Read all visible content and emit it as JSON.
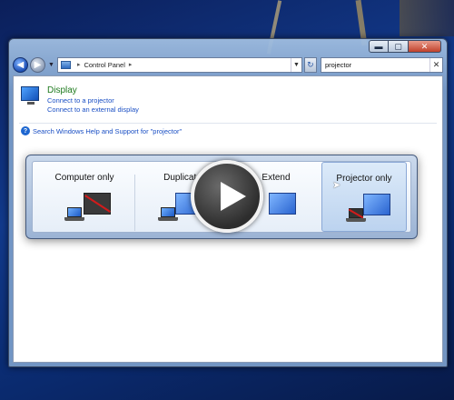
{
  "window": {
    "caption_buttons": {
      "minimize": "▬",
      "maximize": "▢",
      "close": "✕"
    }
  },
  "navbar": {
    "back_icon": "left-arrow-icon",
    "forward_icon": "right-arrow-icon",
    "address": {
      "root_label": "Control Panel",
      "separator": "▸"
    },
    "refresh_icon": "refresh-icon",
    "search_value": "projector"
  },
  "results": {
    "title": "Display",
    "links": [
      "Connect to a projector",
      "Connect to an external display"
    ]
  },
  "help": {
    "text": "Search Windows Help and Support for \"projector\""
  },
  "switcher": {
    "options": [
      {
        "label": "Computer only",
        "selected": false
      },
      {
        "label": "Duplicate",
        "selected": false
      },
      {
        "label": "Extend",
        "selected": true
      },
      {
        "label": "Projector only",
        "selected": true
      }
    ]
  },
  "video_overlay": {
    "icon": "play-icon"
  },
  "colors": {
    "link": "#1a4fc4",
    "result_title": "#1e7a1e",
    "accent_blue": "#2a64d0",
    "disabled_red": "#d21b1b"
  }
}
